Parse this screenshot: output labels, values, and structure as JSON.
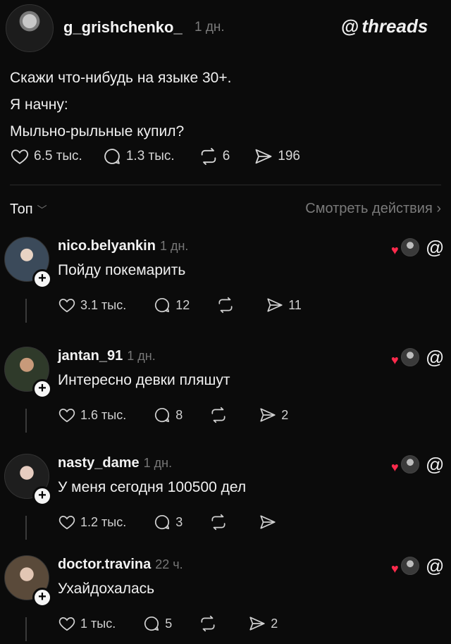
{
  "post": {
    "username": "g_grishchenko_",
    "time": "1 дн.",
    "brand": "threads",
    "brand_glyph": "@",
    "text_lines": [
      "Скажи что-нибудь на языке 30+.",
      "Я начну:",
      "Мыльно-рыльные купил?"
    ],
    "stats": {
      "likes": "6.5 тыс.",
      "replies": "1.3 тыс.",
      "reposts": "6",
      "shares": "196"
    }
  },
  "sort": {
    "label": "Топ",
    "view_actions": "Смотреть действия ›"
  },
  "comments": [
    {
      "username": "nico.belyankin",
      "time": "1 дн.",
      "text": "Пойду покемарить",
      "likes": "3.1 тыс.",
      "replies": "12",
      "reposts": "",
      "shares": "11"
    },
    {
      "username": "jantan_91",
      "time": "1 дн.",
      "text": "Интересно девки пляшут",
      "likes": "1.6 тыс.",
      "replies": "8",
      "reposts": "",
      "shares": "2"
    },
    {
      "username": "nasty_dame",
      "time": "1 дн.",
      "text": "У меня сегодня 100500 дел",
      "likes": "1.2 тыс.",
      "replies": "3",
      "reposts": "",
      "shares": ""
    },
    {
      "username": "doctor.travina",
      "time": "22 ч.",
      "text": "Ухайдохалась",
      "likes": "1 тыс.",
      "replies": "5",
      "reposts": "",
      "shares": "2"
    }
  ],
  "icons": [
    "heart-icon",
    "reply-icon",
    "repost-icon",
    "share-icon",
    "threads-icon",
    "chevron-down-icon",
    "plus-icon"
  ],
  "colors": {
    "background": "#0b0b0b",
    "text": "#f3f3f3",
    "muted": "#7b7b7b",
    "heart": "#ff2a4c"
  }
}
